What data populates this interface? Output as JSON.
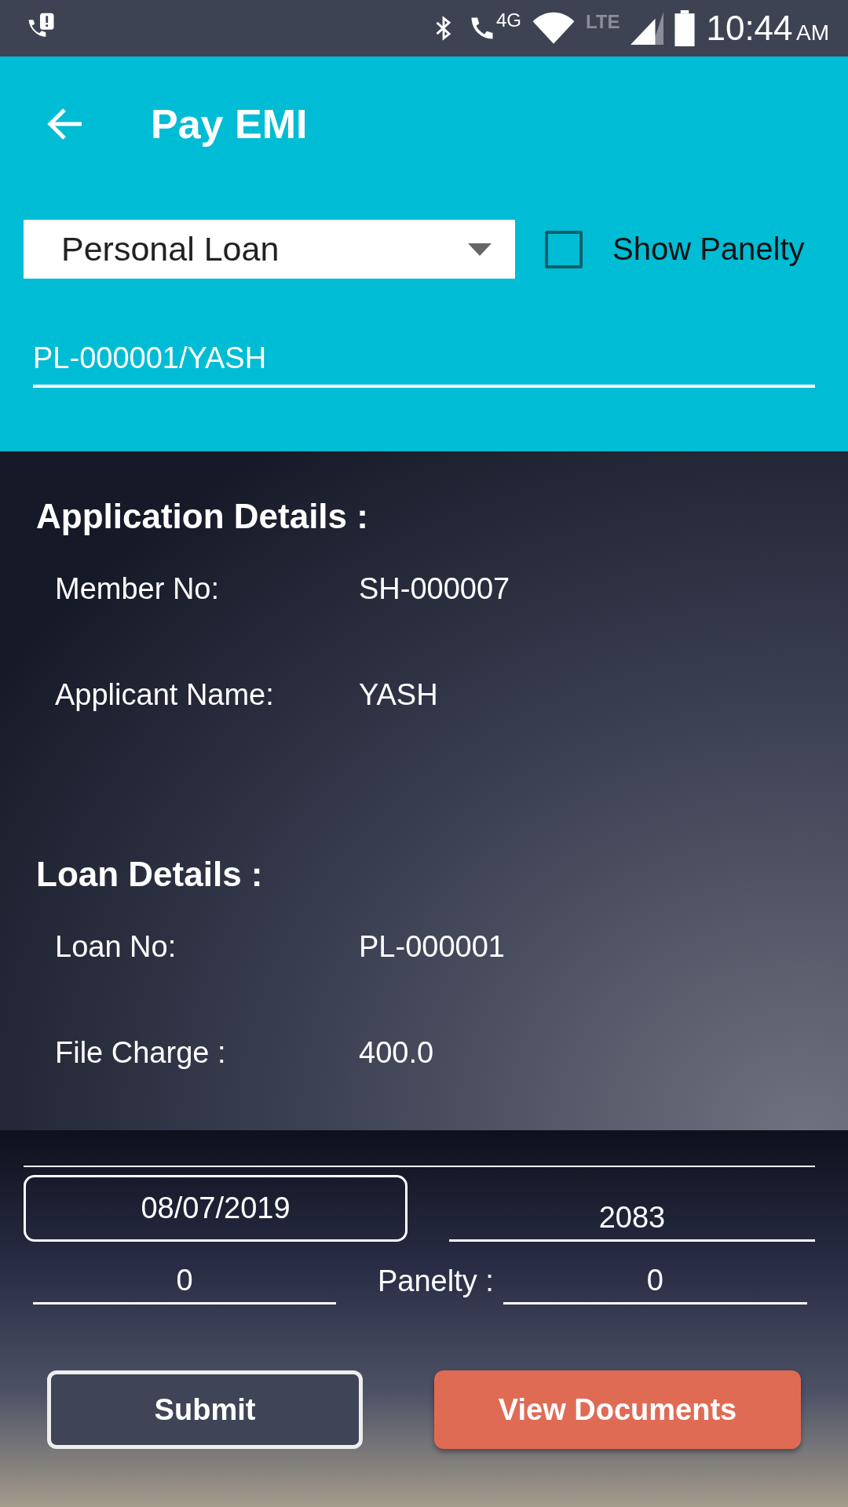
{
  "status_bar": {
    "time": "10:44",
    "am_pm": "AM",
    "network_label": "4G",
    "lte_label": "LTE"
  },
  "header": {
    "title": "Pay EMI"
  },
  "loan_type": {
    "value": "Personal Loan"
  },
  "show_penalty": {
    "label": "Show Panelty",
    "checked": false
  },
  "loan_account": {
    "value": "PL-000001/YASH"
  },
  "sections": [
    {
      "title": "Application Details :",
      "rows": [
        {
          "label": "Member No:",
          "value": "SH-000007"
        },
        {
          "label": "Applicant Name:",
          "value": "YASH"
        }
      ]
    },
    {
      "title": "Loan Details :",
      "rows": [
        {
          "label": "Loan No:",
          "value": "PL-000001"
        },
        {
          "label": "File Charge :",
          "value": "400.0"
        }
      ]
    }
  ],
  "payment": {
    "date": "08/07/2019",
    "amount": "2083",
    "field_3": "0",
    "penalty_label": "Panelty :",
    "penalty": "0"
  },
  "buttons": [
    {
      "label": "Submit",
      "kind": "outline"
    },
    {
      "label": "View Documents",
      "kind": "filled"
    }
  ]
}
